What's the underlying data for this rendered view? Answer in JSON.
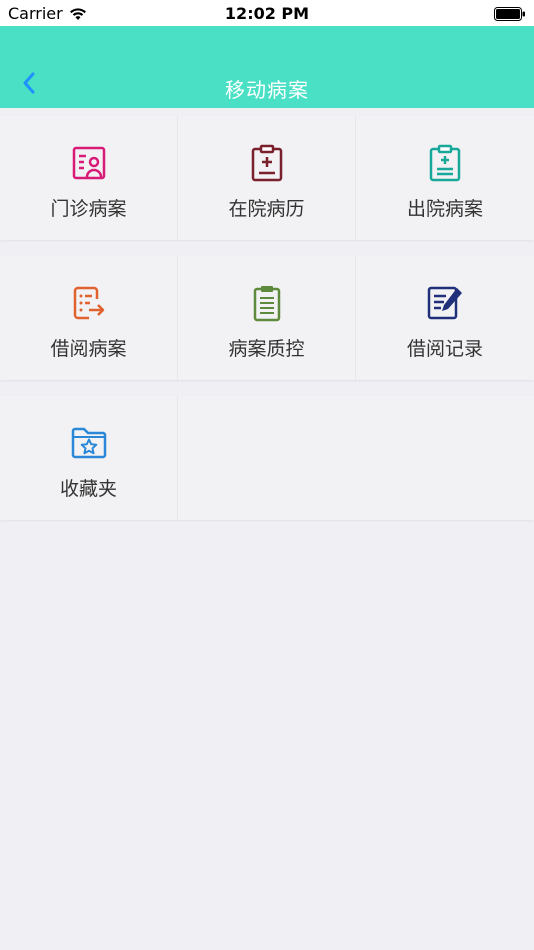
{
  "status_bar": {
    "carrier": "Carrier",
    "time": "12:02 PM"
  },
  "nav": {
    "title": "移动病案"
  },
  "colors": {
    "nav_bg": "#4ae0c5",
    "back_arrow": "#1e90ff",
    "outpatient": "#d81b77",
    "inpatient": "#7a1f2c",
    "discharge": "#18a89a",
    "borrow": "#e0622e",
    "quality": "#5e8a3d",
    "borrow_record": "#1f2f7a",
    "favorites": "#2b88d8"
  },
  "menu": [
    {
      "label": "门诊病案",
      "icon": "patient-card-icon"
    },
    {
      "label": "在院病历",
      "icon": "clipboard-plus-icon"
    },
    {
      "label": "出院病案",
      "icon": "clipboard-medical-icon"
    },
    {
      "label": "借阅病案",
      "icon": "document-export-icon"
    },
    {
      "label": "病案质控",
      "icon": "clipboard-list-icon"
    },
    {
      "label": "借阅记录",
      "icon": "document-edit-icon"
    },
    {
      "label": "收藏夹",
      "icon": "folder-star-icon"
    }
  ]
}
